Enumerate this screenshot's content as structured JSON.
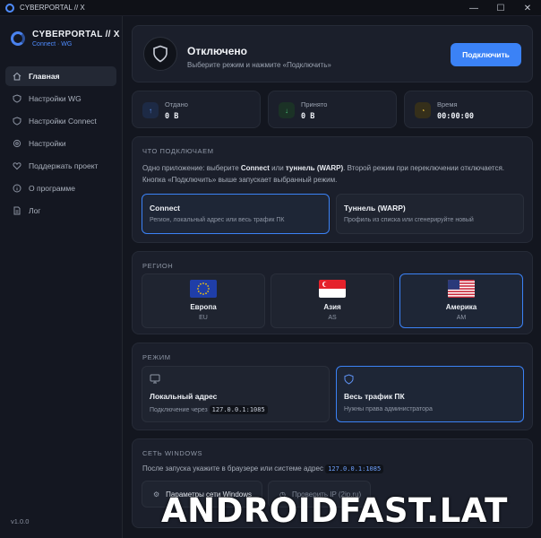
{
  "window": {
    "title": "CYBERPORTAL // X",
    "controls": [
      "—",
      "☐",
      "✕"
    ]
  },
  "brand": {
    "name": "CYBERPORTAL // X",
    "sub": "Connect · WG"
  },
  "sidebar": {
    "items": [
      {
        "label": "Главная",
        "icon": "home-icon",
        "active": true
      },
      {
        "label": "Настройки WG",
        "icon": "shield-icon"
      },
      {
        "label": "Настройки Connect",
        "icon": "shield-icon"
      },
      {
        "label": "Настройки",
        "icon": "gear-icon"
      },
      {
        "label": "Поддержать проект",
        "icon": "heart-icon"
      },
      {
        "label": "О программе",
        "icon": "info-icon"
      },
      {
        "label": "Лог",
        "icon": "document-icon"
      }
    ],
    "version": "v1.0.0"
  },
  "status": {
    "title": "Отключено",
    "subtitle": "Выберите режим и нажмите «Подключить»",
    "button": "Подключить"
  },
  "stats": [
    {
      "label": "Отдано",
      "value": "0 B",
      "icon": "arrow-up-icon",
      "color": "#3b82f6"
    },
    {
      "label": "Принято",
      "value": "0 B",
      "icon": "arrow-down-icon",
      "color": "#22c55e"
    },
    {
      "label": "Время",
      "value": "00:00:00",
      "icon": "clock-icon",
      "color": "#eab308"
    }
  ],
  "what": {
    "title": "ЧТО ПОДКЛЮЧАЕМ",
    "desc_1": "Одно приложение: выберите ",
    "desc_b1": "Connect",
    "desc_2": " или ",
    "desc_b2": "туннель (WARP)",
    "desc_3": ". Второй режим при переключении отключается.",
    "desc_line2": "Кнопка «Подключить» выше запускает выбранный режим.",
    "options": [
      {
        "title": "Connect",
        "sub": "Регион, локальный адрес или весь трафик ПК",
        "selected": true
      },
      {
        "title": "Туннель (WARP)",
        "sub": "Профиль из списка или сгенерируйте новый",
        "selected": false
      }
    ]
  },
  "region": {
    "title": "РЕГИОН",
    "items": [
      {
        "name": "Европа",
        "code": "EU",
        "flag": "eu-flag-icon",
        "selected": false
      },
      {
        "name": "Азия",
        "code": "AS",
        "flag": "singapore-flag-icon",
        "selected": false
      },
      {
        "name": "Америка",
        "code": "AM",
        "flag": "usa-flag-icon",
        "selected": true
      }
    ]
  },
  "mode": {
    "title": "РЕЖИМ",
    "items": [
      {
        "title": "Локальный адрес",
        "sub": "Подключение через",
        "code": "127.0.0.1:1085",
        "icon": "monitor-icon",
        "selected": false
      },
      {
        "title": "Весь трафик ПК",
        "sub": "Нужны права администратора",
        "icon": "shield-icon",
        "selected": true
      }
    ]
  },
  "windows": {
    "title": "СЕТЬ WINDOWS",
    "desc": "После запуска укажите в браузере или системе адрес",
    "code": "127.0.0.1:1085",
    "buttons": [
      {
        "label": "Параметры сети Windows",
        "icon": "gear-icon"
      },
      {
        "label": "Проверить IP (2ip.ru)",
        "icon": "clock-icon"
      }
    ]
  },
  "watermark": "ANDROIDFAST.LAT"
}
